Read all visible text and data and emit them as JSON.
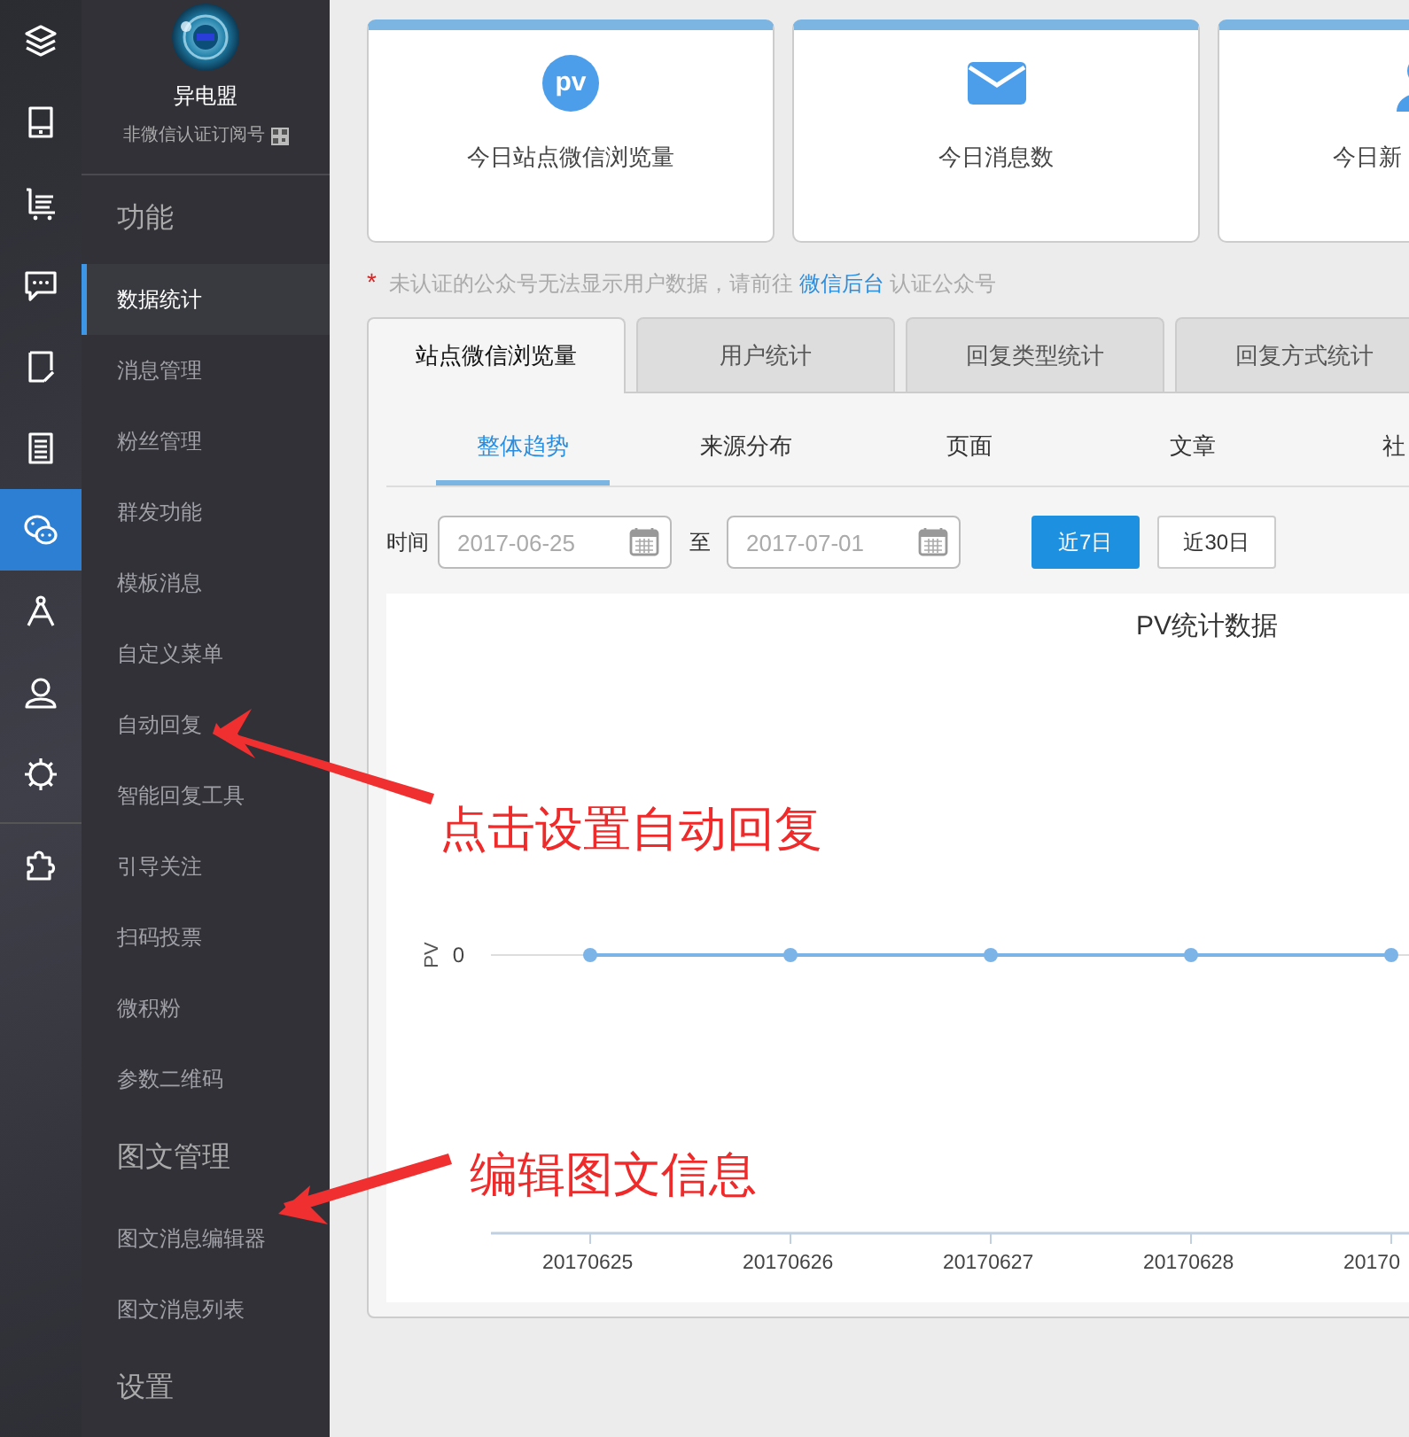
{
  "icon_rail": {
    "top_items": [
      {
        "kind": "layers",
        "selected": false
      },
      {
        "kind": "tablet",
        "selected": false
      },
      {
        "kind": "cart",
        "selected": false
      },
      {
        "kind": "chat",
        "selected": false
      },
      {
        "kind": "note",
        "selected": false
      },
      {
        "kind": "list",
        "selected": false
      },
      {
        "kind": "wechat",
        "selected": true
      },
      {
        "kind": "compass",
        "selected": false
      },
      {
        "kind": "user",
        "selected": false
      },
      {
        "kind": "gear",
        "selected": false
      }
    ],
    "bottom_items": [
      {
        "kind": "puzzle",
        "selected": false
      }
    ]
  },
  "sidebar": {
    "account": {
      "name": "异电盟",
      "type": "非微信认证订阅号"
    },
    "sections": [
      {
        "title": "功能",
        "items": [
          {
            "label": "数据统计",
            "selected": true
          },
          {
            "label": "消息管理",
            "selected": false
          },
          {
            "label": "粉丝管理",
            "selected": false
          },
          {
            "label": "群发功能",
            "selected": false
          },
          {
            "label": "模板消息",
            "selected": false
          },
          {
            "label": "自定义菜单",
            "selected": false
          },
          {
            "label": "自动回复",
            "selected": false
          },
          {
            "label": "智能回复工具",
            "selected": false
          },
          {
            "label": "引导关注",
            "selected": false
          },
          {
            "label": "扫码投票",
            "selected": false
          },
          {
            "label": "微积粉",
            "selected": false
          },
          {
            "label": "参数二维码",
            "selected": false
          }
        ]
      },
      {
        "title": "图文管理",
        "items": [
          {
            "label": "图文消息编辑器",
            "selected": false
          },
          {
            "label": "图文消息列表",
            "selected": false
          }
        ]
      },
      {
        "title": "设置"
      }
    ]
  },
  "stat_cards": [
    {
      "kind": "pv",
      "badge": "pv",
      "label": "今日站点微信浏览量"
    },
    {
      "kind": "mail",
      "label": "今日消息数"
    },
    {
      "kind": "user",
      "label": "今日新"
    }
  ],
  "notice": {
    "mark": "*",
    "text_before": "未认证的公众号无法显示用户数据，请前往",
    "link": "微信后台",
    "text_after": "认证公众号"
  },
  "tabs": [
    {
      "label": "站点微信浏览量",
      "selected": true
    },
    {
      "label": "用户统计",
      "selected": false
    },
    {
      "label": "回复类型统计",
      "selected": false
    },
    {
      "label": "回复方式统计",
      "selected": false
    }
  ],
  "subtabs": [
    {
      "label": "整体趋势",
      "selected": true
    },
    {
      "label": "来源分布",
      "selected": false
    },
    {
      "label": "页面",
      "selected": false
    },
    {
      "label": "文章",
      "selected": false
    },
    {
      "label": "社",
      "selected": false
    }
  ],
  "date_filter": {
    "label": "时间",
    "start": "2017-06-25",
    "separator": "至",
    "end": "2017-07-01",
    "ranges": [
      {
        "label": "近7日",
        "selected": true
      },
      {
        "label": "近30日",
        "selected": false
      }
    ]
  },
  "chart": {
    "title": "PV统计数据",
    "ylabel": "PV",
    "x_labels": [
      "20170625",
      "20170626",
      "20170627",
      "20170628",
      "20170"
    ],
    "baseline_label": "0"
  },
  "annotations": [
    {
      "text": "点击设置自动回复"
    },
    {
      "text": "编辑图文信息"
    }
  ]
}
